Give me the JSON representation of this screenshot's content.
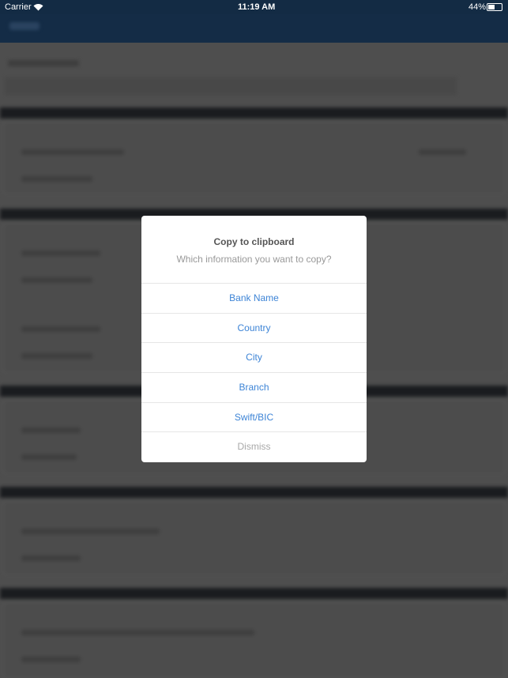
{
  "status_bar": {
    "carrier": "Carrier",
    "time": "11:19 AM",
    "battery": "44%",
    "icons": [
      "wifi-icon",
      "battery-icon"
    ]
  },
  "colors": {
    "nav": "#142c46",
    "accent": "#3d84d6",
    "overlay": "#4e4e4e"
  },
  "dialog": {
    "title": "Copy to clipboard",
    "subtitle": "Which information you want to copy?",
    "options": [
      {
        "label": "Bank Name"
      },
      {
        "label": "Country"
      },
      {
        "label": "City"
      },
      {
        "label": "Branch"
      },
      {
        "label": "Swift/BIC"
      }
    ],
    "dismiss": "Dismiss"
  }
}
